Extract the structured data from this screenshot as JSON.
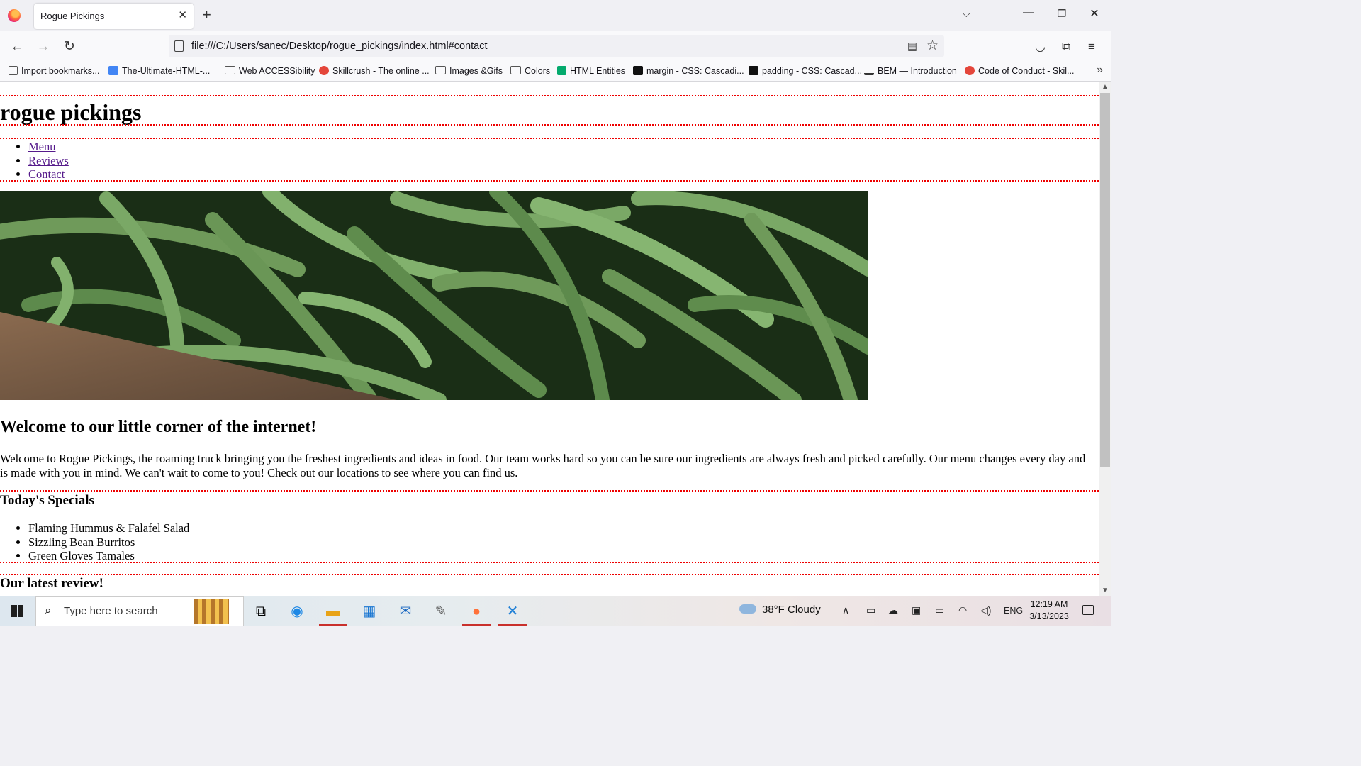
{
  "browser": {
    "tab_title": "Rogue Pickings",
    "url": "file:///C:/Users/sanec/Desktop/rogue_pickings/index.html#contact",
    "bookmarks": [
      {
        "label": "Import bookmarks...",
        "icon": "import-icon"
      },
      {
        "label": "The-Ultimate-HTML-...",
        "icon": "doc-icon"
      },
      {
        "label": "Web ACCESSibility",
        "icon": "folder-icon"
      },
      {
        "label": "Skillcrush - The online ...",
        "icon": "skillcrush-icon"
      },
      {
        "label": "Images &Gifs",
        "icon": "folder-icon"
      },
      {
        "label": "Colors",
        "icon": "folder-icon"
      },
      {
        "label": "HTML Entities",
        "icon": "w3-icon"
      },
      {
        "label": "margin - CSS: Cascadi...",
        "icon": "mdn-icon"
      },
      {
        "label": "padding - CSS: Cascad...",
        "icon": "mdn-icon"
      },
      {
        "label": "BEM — Introduction",
        "icon": "bem-icon"
      },
      {
        "label": "Code of Conduct - Skil...",
        "icon": "skillcrush-icon"
      }
    ],
    "accent_color": "#ff7139"
  },
  "page": {
    "site_title": "rogue pickings",
    "nav": [
      "Menu",
      "Reviews",
      "Contact"
    ],
    "hero_alt": "green beans in a wooden crate",
    "welcome_heading": "Welcome to our little corner of the internet!",
    "welcome_text": "Welcome to Rogue Pickings, the roaming truck bringing you the freshest ingredients and ideas in food. Our team works hard so you can be sure our ingredients are always fresh and picked carefully. Our menu changes every day and is made with you in mind. We can't wait to come to you! Check out our locations to see where you can find us.",
    "specials_heading": "Today's Specials",
    "specials": [
      "Flaming Hummus & Falafel Salad",
      "Sizzling Bean Burritos",
      "Green Gloves Tamales"
    ],
    "review_heading": "Our latest review!",
    "divider_color": "#e00000"
  },
  "taskbar": {
    "search_placeholder": "Type here to search",
    "weather": "38°F  Cloudy",
    "language": "ENG",
    "time": "12:19 AM",
    "date": "3/13/2023"
  }
}
